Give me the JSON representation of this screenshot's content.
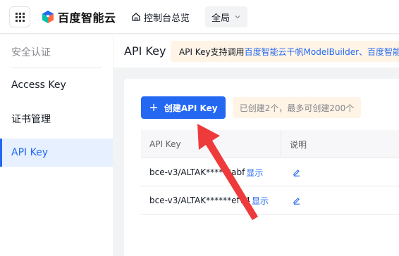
{
  "topbar": {
    "apps_icon": "grid-icon",
    "brand": "百度智能云",
    "console_label": "控制台总览",
    "region_value": "全局"
  },
  "sidebar": {
    "title": "安全认证",
    "items": [
      {
        "label": "Access Key",
        "active": false
      },
      {
        "label": "证书管理",
        "active": false
      },
      {
        "label": "API Key",
        "active": true
      }
    ]
  },
  "header": {
    "title": "API Key",
    "notice_prefix": "API Key支持调用",
    "notice_link": "百度智能云千帆ModelBuilder、百度智能云"
  },
  "toolbar": {
    "create_label": "创建API Key",
    "count_tip": "已创建2个，最多可创建200个"
  },
  "table": {
    "columns": [
      "API Key",
      "说明"
    ],
    "rows": [
      {
        "key": "bce-v3/ALTAK******abf",
        "show": "显示"
      },
      {
        "key": "bce-v3/ALTAK******ef74",
        "show": "显示"
      }
    ]
  },
  "colors": {
    "accent": "#2468f2",
    "annotation_arrow": "#ee3a3a",
    "notice_bg": "#fff4e6"
  }
}
